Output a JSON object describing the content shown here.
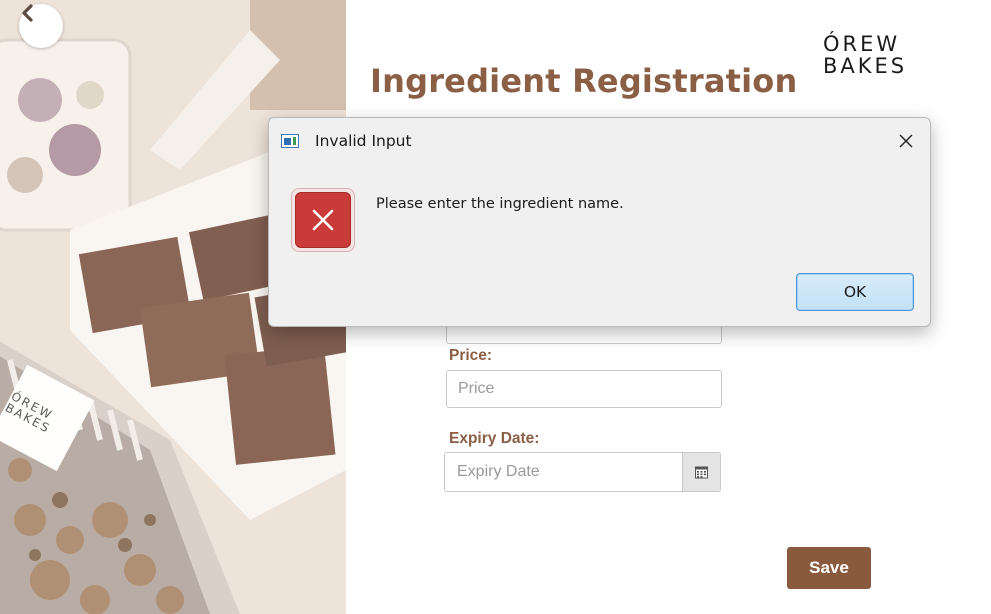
{
  "brand": {
    "logo_line1": "ÓREW",
    "logo_line2": "BAKES"
  },
  "page": {
    "title": "Ingredient Registration"
  },
  "form": {
    "price_label": "Price:",
    "price_placeholder": "Price",
    "price_value": "",
    "expiry_label": "Expiry Date:",
    "expiry_placeholder": "Expiry Date",
    "expiry_value": "",
    "save_label": "Save"
  },
  "dialog": {
    "title": "Invalid Input",
    "message": "Please enter the ingredient name.",
    "ok_label": "OK"
  },
  "photo_package": {
    "logo_line1": "ÓREW",
    "logo_line2": "BAKES"
  },
  "colors": {
    "accent_brown": "#8a5f45",
    "save_button": "#8a5a3f",
    "error_red": "#c93b39",
    "ok_button_border": "#4b95d6"
  },
  "icons": {
    "back": "chevron-left-icon",
    "calendar": "calendar-icon",
    "close": "close-icon",
    "error": "error-icon",
    "app": "app-window-icon"
  }
}
